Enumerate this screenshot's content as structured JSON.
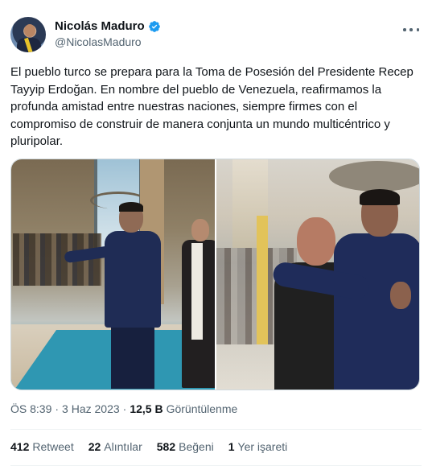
{
  "author": {
    "display_name": "Nicolás Maduro",
    "handle": "@NicolasMaduro",
    "verified_color": "#1d9bf0"
  },
  "tweet": {
    "text": "El pueblo turco se prepara para la Toma de Posesión del Presidente Recep Tayyip Erdoğan. En nombre del pueblo de Venezuela, reafirmamos la profunda amistad entre nuestras naciones, siempre firmes con el compromiso de construir de manera conjunta un mundo multicéntrico y pluripolar."
  },
  "meta": {
    "time": "ÖS 8:39",
    "date": "3 Haz 2023",
    "views_count": "12,5 B",
    "views_label": "Görüntülenme"
  },
  "stats": [
    {
      "count": "412",
      "label": "Retweet"
    },
    {
      "count": "22",
      "label": "Alıntılar"
    },
    {
      "count": "582",
      "label": "Beğeni"
    },
    {
      "count": "1",
      "label": "Yer işareti"
    }
  ]
}
